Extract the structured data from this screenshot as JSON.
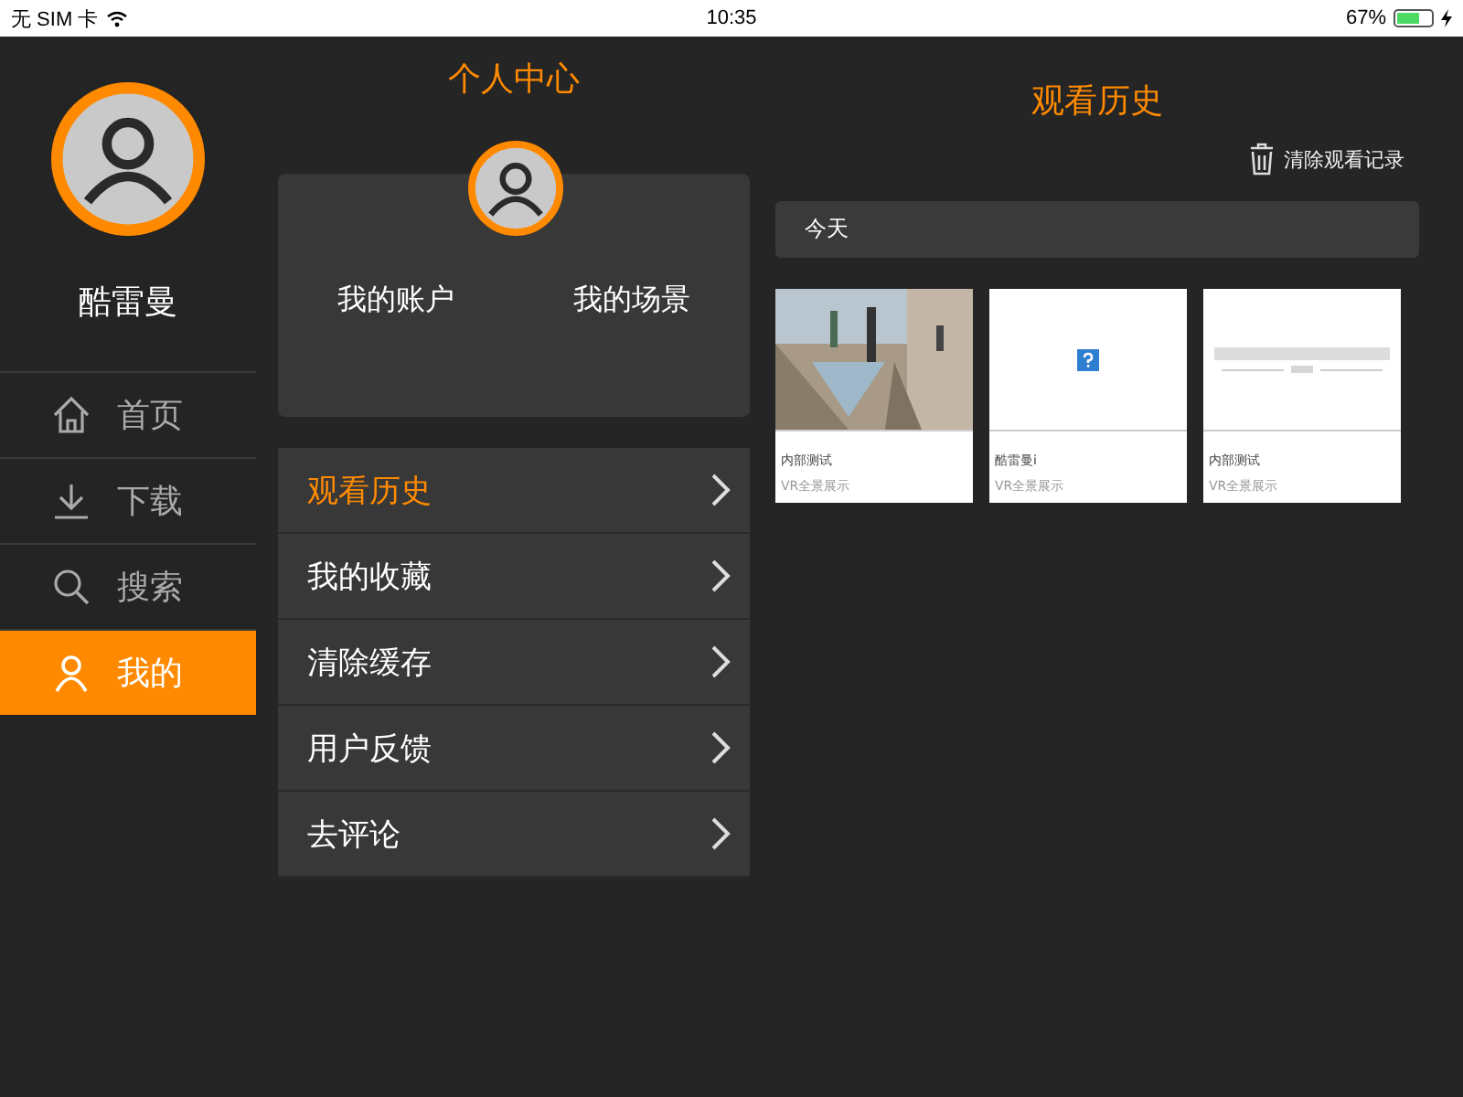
{
  "status_bar": {
    "carrier": "无 SIM 卡",
    "time": "10:35",
    "battery": "67%"
  },
  "sidebar": {
    "user_name": "酷雷曼",
    "nav": [
      {
        "label": "首页",
        "kind": "home",
        "selected": false
      },
      {
        "label": "下载",
        "kind": "download",
        "selected": false
      },
      {
        "label": "搜索",
        "kind": "search",
        "selected": false
      },
      {
        "label": "我的",
        "kind": "user",
        "selected": true
      }
    ]
  },
  "profile": {
    "title": "个人中心",
    "buttons": [
      "我的账户",
      "我的场景"
    ],
    "menu": [
      {
        "label": "观看历史",
        "selected": true
      },
      {
        "label": "我的收藏",
        "selected": false
      },
      {
        "label": "清除缓存",
        "selected": false
      },
      {
        "label": "用户反馈",
        "selected": false
      },
      {
        "label": "去评论",
        "selected": false
      }
    ]
  },
  "history": {
    "title": "观看历史",
    "clear_label": "清除观看记录",
    "sections": [
      {
        "title": "今天",
        "items": [
          {
            "title": "内部测试",
            "subtitle": "VR全景展示"
          },
          {
            "kind": "missing",
            "title": "酷雷曼i",
            "subtitle": "VR全景展示"
          },
          {
            "kind": "logo",
            "title": "内部测试",
            "subtitle": "VR全景展示"
          }
        ]
      }
    ]
  }
}
